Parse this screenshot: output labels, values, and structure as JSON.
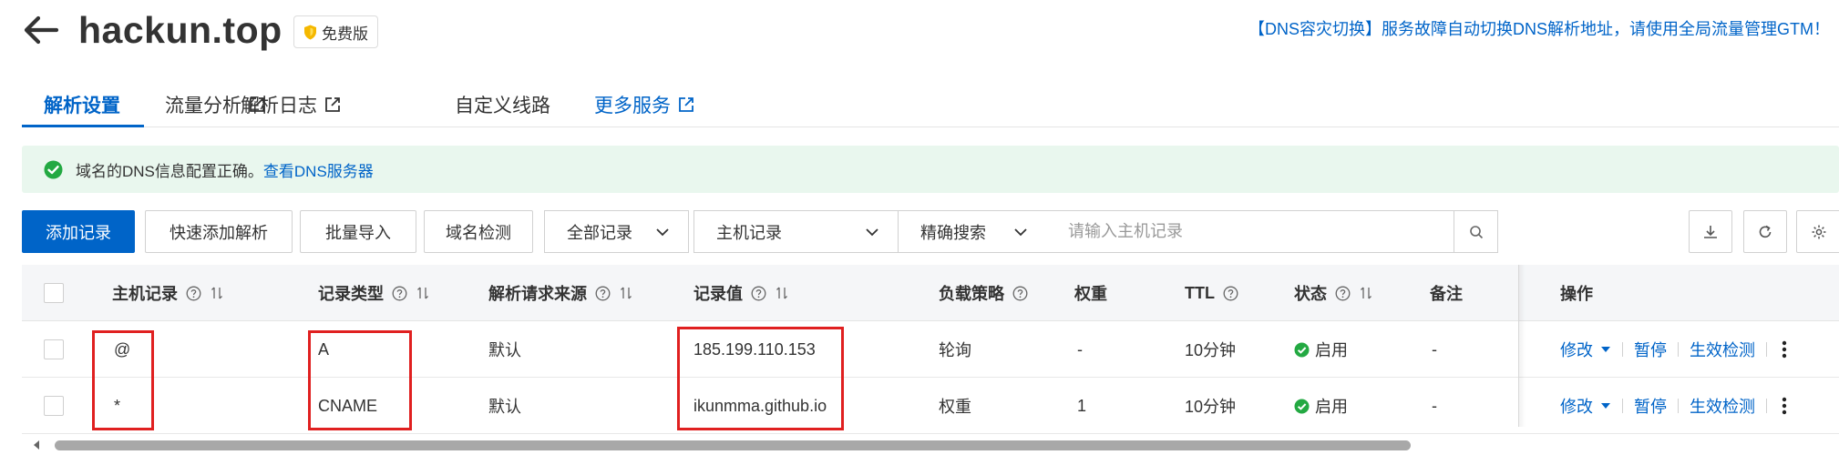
{
  "header": {
    "domain": "hackun.top",
    "edition_badge": "免费版",
    "gtm_banner": "【DNS容灾切换】服务故障自动切换DNS解析地址，请使用全局流量管理GTM！"
  },
  "tabs": [
    {
      "label": "解析设置",
      "active": true,
      "external": false
    },
    {
      "label": "流量分析",
      "active": false,
      "external": true
    },
    {
      "label": "解析日志",
      "active": false,
      "external": true
    },
    {
      "label": "自定义线路",
      "active": false,
      "external": false
    },
    {
      "label": "更多服务",
      "active": false,
      "external": true
    }
  ],
  "notice": {
    "text": "域名的DNS信息配置正确。",
    "link": "查看DNS服务器",
    "color": "#e9f7ee"
  },
  "toolbar": {
    "add_record": "添加记录",
    "quick_add": "快速添加解析",
    "bulk_import": "批量导入",
    "domain_check": "域名检测",
    "record_filter": "全部记录",
    "field_select": "主机记录",
    "match_mode": "精确搜索",
    "search_placeholder": "请输入主机记录"
  },
  "table": {
    "columns": [
      "主机记录",
      "记录类型",
      "解析请求来源",
      "记录值",
      "负载策略",
      "权重",
      "TTL",
      "状态",
      "备注",
      "操作"
    ],
    "rows": [
      {
        "host": "@",
        "type": "A",
        "line": "默认",
        "value": "185.199.110.153",
        "policy": "轮询",
        "weight": "-",
        "ttl": "10分钟",
        "status": "启用",
        "remark": "-"
      },
      {
        "host": "*",
        "type": "CNAME",
        "line": "默认",
        "value": "ikunmma.github.io",
        "policy": "权重",
        "weight": "1",
        "ttl": "10分钟",
        "status": "启用",
        "remark": "-"
      }
    ],
    "ops": {
      "modify": "修改",
      "pause": "暂停",
      "verify": "生效检测"
    }
  },
  "colors": {
    "brand": "#0064c8",
    "success": "#23a942",
    "highlight": "#e02020"
  }
}
